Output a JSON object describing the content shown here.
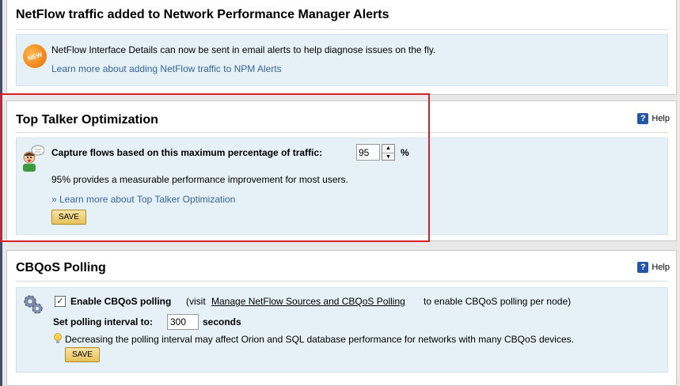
{
  "netflow_alerts": {
    "title": "NetFlow traffic added to Network Performance Manager Alerts",
    "badge": "NEW",
    "description": "NetFlow Interface Details can now be sent in email alerts to help diagnose issues on the fly.",
    "link": "Learn more about adding NetFlow traffic to NPM Alerts"
  },
  "top_talker": {
    "title": "Top Talker Optimization",
    "help_label": "Help",
    "capture_label": "Capture flows based on this maximum percentage of traffic:",
    "capture_value": "95",
    "unit": "%",
    "note": "95% provides a measurable performance improvement for most users.",
    "link": "» Learn more about Top Talker Optimization",
    "save_label": "SAVE"
  },
  "cbqos": {
    "title": "CBQoS Polling",
    "help_label": "Help",
    "enable_label": "Enable CBQoS polling",
    "enable_checked": true,
    "visit_prefix": "(visit",
    "manage_link": "Manage NetFlow Sources and CBQoS Polling",
    "visit_suffix": "to enable CBQoS polling per node)",
    "interval_label": "Set polling interval to:",
    "interval_value": "300",
    "interval_unit": "seconds",
    "warning": "Decreasing the polling interval may affect Orion and SQL database performance for networks with many CBQoS devices.",
    "save_label": "SAVE"
  },
  "colors": {
    "highlight": "#d6202a",
    "link": "#336699",
    "info_box": "#e6f0f7",
    "button": "#e8c25b"
  },
  "icons": [
    "new-badge-icon",
    "help-icon",
    "talker-avatar-icon",
    "gears-icon",
    "lightbulb-icon",
    "spin-up-icon",
    "spin-down-icon",
    "checkbox-icon"
  ]
}
